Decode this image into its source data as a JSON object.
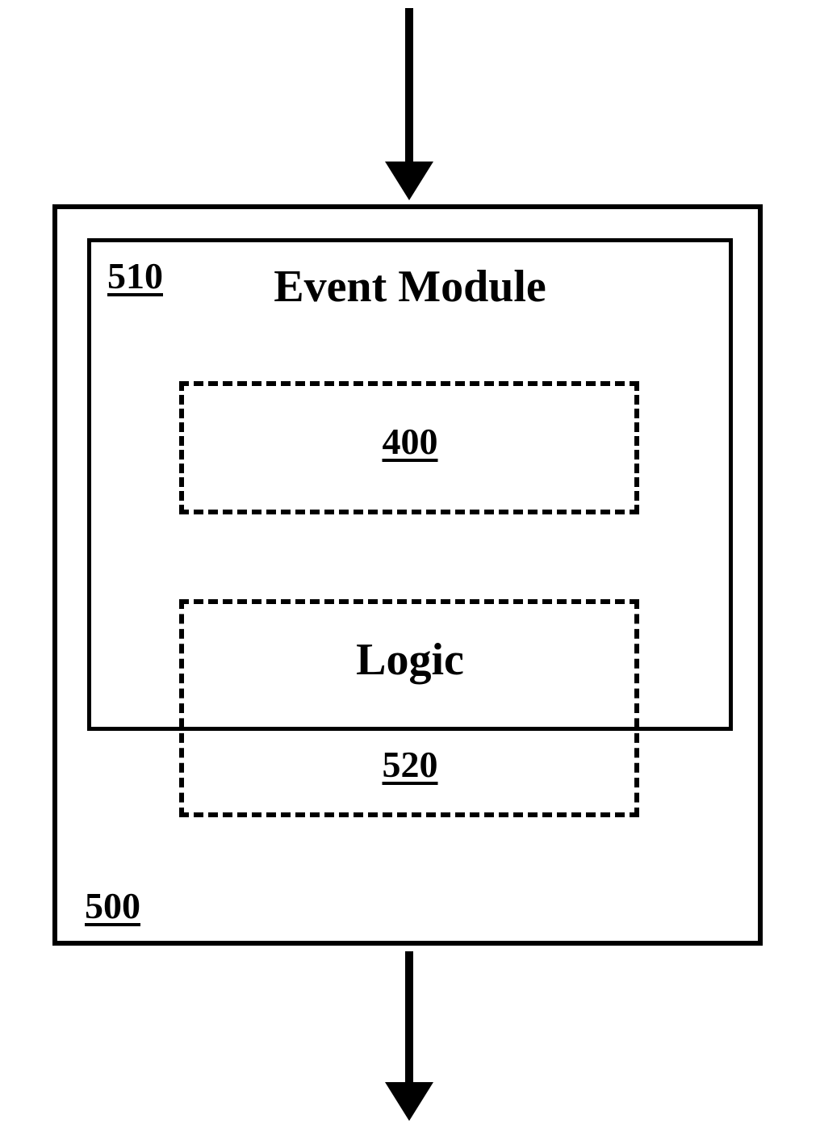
{
  "outer": {
    "ref": "500"
  },
  "event_module": {
    "ref": "510",
    "title": "Event Module"
  },
  "box_400": {
    "ref": "400"
  },
  "logic": {
    "ref": "520",
    "title": "Logic"
  }
}
